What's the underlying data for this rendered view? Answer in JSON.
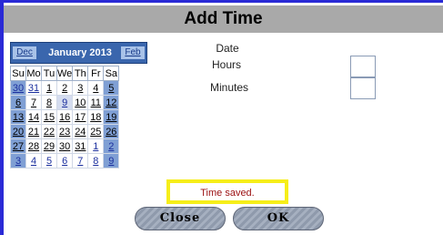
{
  "dialog": {
    "title": "Add Time"
  },
  "form": {
    "date_label": "Date",
    "hours_label": "Hours",
    "minutes_label": "Minutes",
    "hours_value": "",
    "minutes_value": ""
  },
  "calendar": {
    "prev_label": "Dec",
    "month_label": "January 2013",
    "next_label": "Feb",
    "weekdays": [
      "Su",
      "Mo",
      "Tu",
      "We",
      "Th",
      "Fr",
      "Sa"
    ],
    "weeks": [
      [
        "30",
        "31",
        "1",
        "2",
        "3",
        "4",
        "5"
      ],
      [
        "6",
        "7",
        "8",
        "9",
        "10",
        "11",
        "12"
      ],
      [
        "13",
        "14",
        "15",
        "16",
        "17",
        "18",
        "19"
      ],
      [
        "20",
        "21",
        "22",
        "23",
        "24",
        "25",
        "26"
      ],
      [
        "27",
        "28",
        "29",
        "30",
        "31",
        "1",
        "2"
      ],
      [
        "3",
        "4",
        "5",
        "6",
        "7",
        "8",
        "9"
      ]
    ],
    "selected": "9"
  },
  "status": {
    "message": "Time saved."
  },
  "buttons": {
    "close_label": "Close",
    "ok_label": "OK"
  },
  "colors": {
    "accent": "#3a66ad",
    "weekend": "#7f9fd4",
    "status_border": "#f6ee1a",
    "status_text": "#9b1010"
  }
}
